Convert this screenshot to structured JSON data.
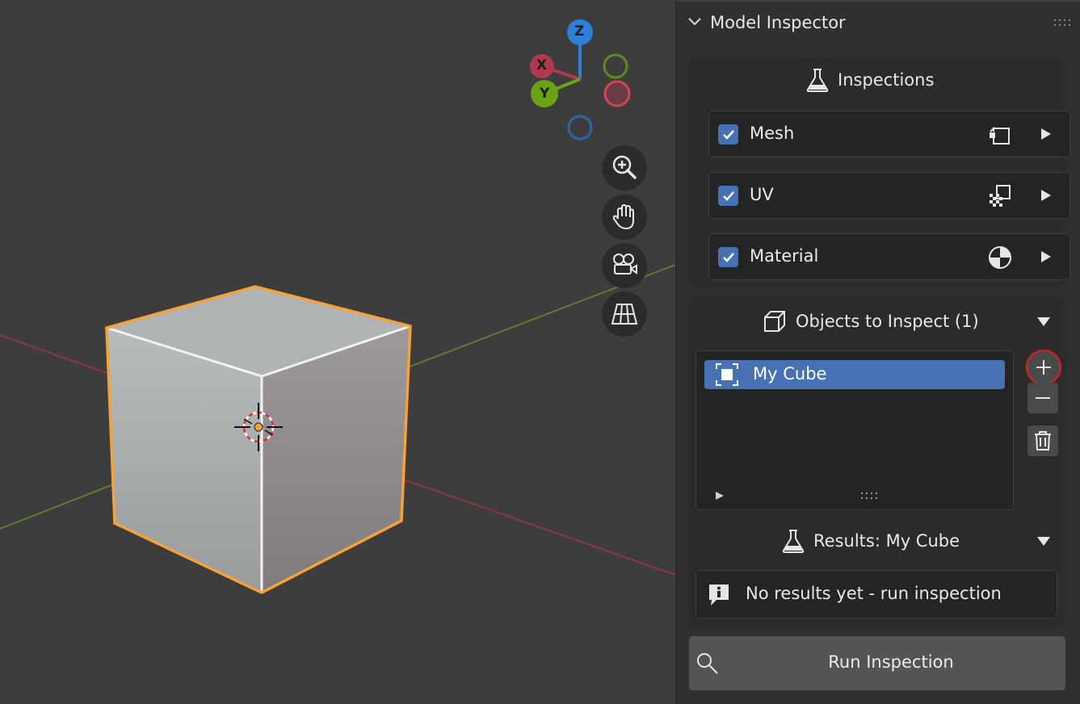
{
  "panel": {
    "title": "Model Inspector",
    "inspections": {
      "title": "Inspections",
      "items": [
        {
          "label": "Mesh",
          "checked": true,
          "icon": "mesh-icon"
        },
        {
          "label": "UV",
          "checked": true,
          "icon": "uv-checker-icon"
        },
        {
          "label": "Material",
          "checked": true,
          "icon": "material-icon"
        }
      ]
    },
    "objects": {
      "title": "Objects to Inspect (1)",
      "items": [
        {
          "label": "My Cube",
          "selected": true,
          "icon": "object-icon"
        }
      ]
    },
    "results": {
      "title": "Results: My Cube",
      "message": "No results yet - run inspection"
    },
    "run_button": "Run Inspection"
  },
  "gizmo": {
    "x_label": "X",
    "y_label": "Y",
    "z_label": "Z"
  },
  "colors": {
    "accent_blue": "#4672b3",
    "selection_outline": "#f5a23a",
    "axis_x": "#d4435a",
    "axis_y": "#7ab51d",
    "axis_z": "#2d7fd8",
    "highlight_ring": "#e02020"
  }
}
